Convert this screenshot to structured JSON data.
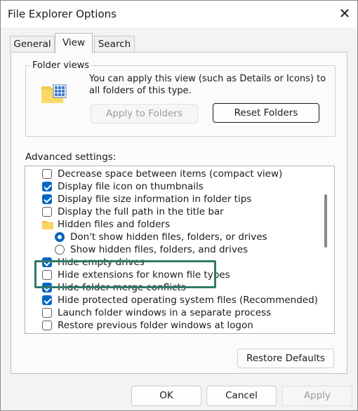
{
  "window": {
    "title": "File Explorer Options"
  },
  "tabs": [
    {
      "label": "General",
      "active": false
    },
    {
      "label": "View",
      "active": true
    },
    {
      "label": "Search",
      "active": false
    }
  ],
  "folder_views": {
    "legend": "Folder views",
    "description": "You can apply this view (such as Details or Icons) to all folders of this type.",
    "apply_button": "Apply to Folders",
    "reset_button": "Reset Folders"
  },
  "advanced": {
    "label": "Advanced settings:",
    "items": [
      {
        "kind": "checkbox",
        "checked": false,
        "label": "Decrease space between items (compact view)"
      },
      {
        "kind": "checkbox",
        "checked": true,
        "label": "Display file icon on thumbnails"
      },
      {
        "kind": "checkbox",
        "checked": true,
        "label": "Display file size information in folder tips"
      },
      {
        "kind": "checkbox",
        "checked": false,
        "label": "Display the full path in the title bar"
      },
      {
        "kind": "folder",
        "label": "Hidden files and folders"
      },
      {
        "kind": "radio",
        "checked": true,
        "label": "Don't show hidden files, folders, or drives"
      },
      {
        "kind": "radio",
        "checked": false,
        "label": "Show hidden files, folders, and drives"
      },
      {
        "kind": "checkbox",
        "checked": true,
        "label": "Hide empty drives"
      },
      {
        "kind": "checkbox",
        "checked": false,
        "label": "Hide extensions for known file types"
      },
      {
        "kind": "checkbox",
        "checked": true,
        "label": "Hide folder merge conflicts"
      },
      {
        "kind": "checkbox",
        "checked": true,
        "label": "Hide protected operating system files (Recommended)"
      },
      {
        "kind": "checkbox",
        "checked": false,
        "label": "Launch folder windows in a separate process"
      },
      {
        "kind": "checkbox",
        "checked": false,
        "label": "Restore previous folder windows at logon"
      }
    ],
    "restore_defaults": "Restore Defaults"
  },
  "footer": {
    "ok": "OK",
    "cancel": "Cancel",
    "apply": "Apply"
  },
  "colors": {
    "accent": "#0567c1",
    "highlight_box": "#2f7a6a"
  },
  "icons": {
    "close": "close-icon",
    "folder_views": "folder-grid-icon",
    "group": "folder-icon"
  }
}
